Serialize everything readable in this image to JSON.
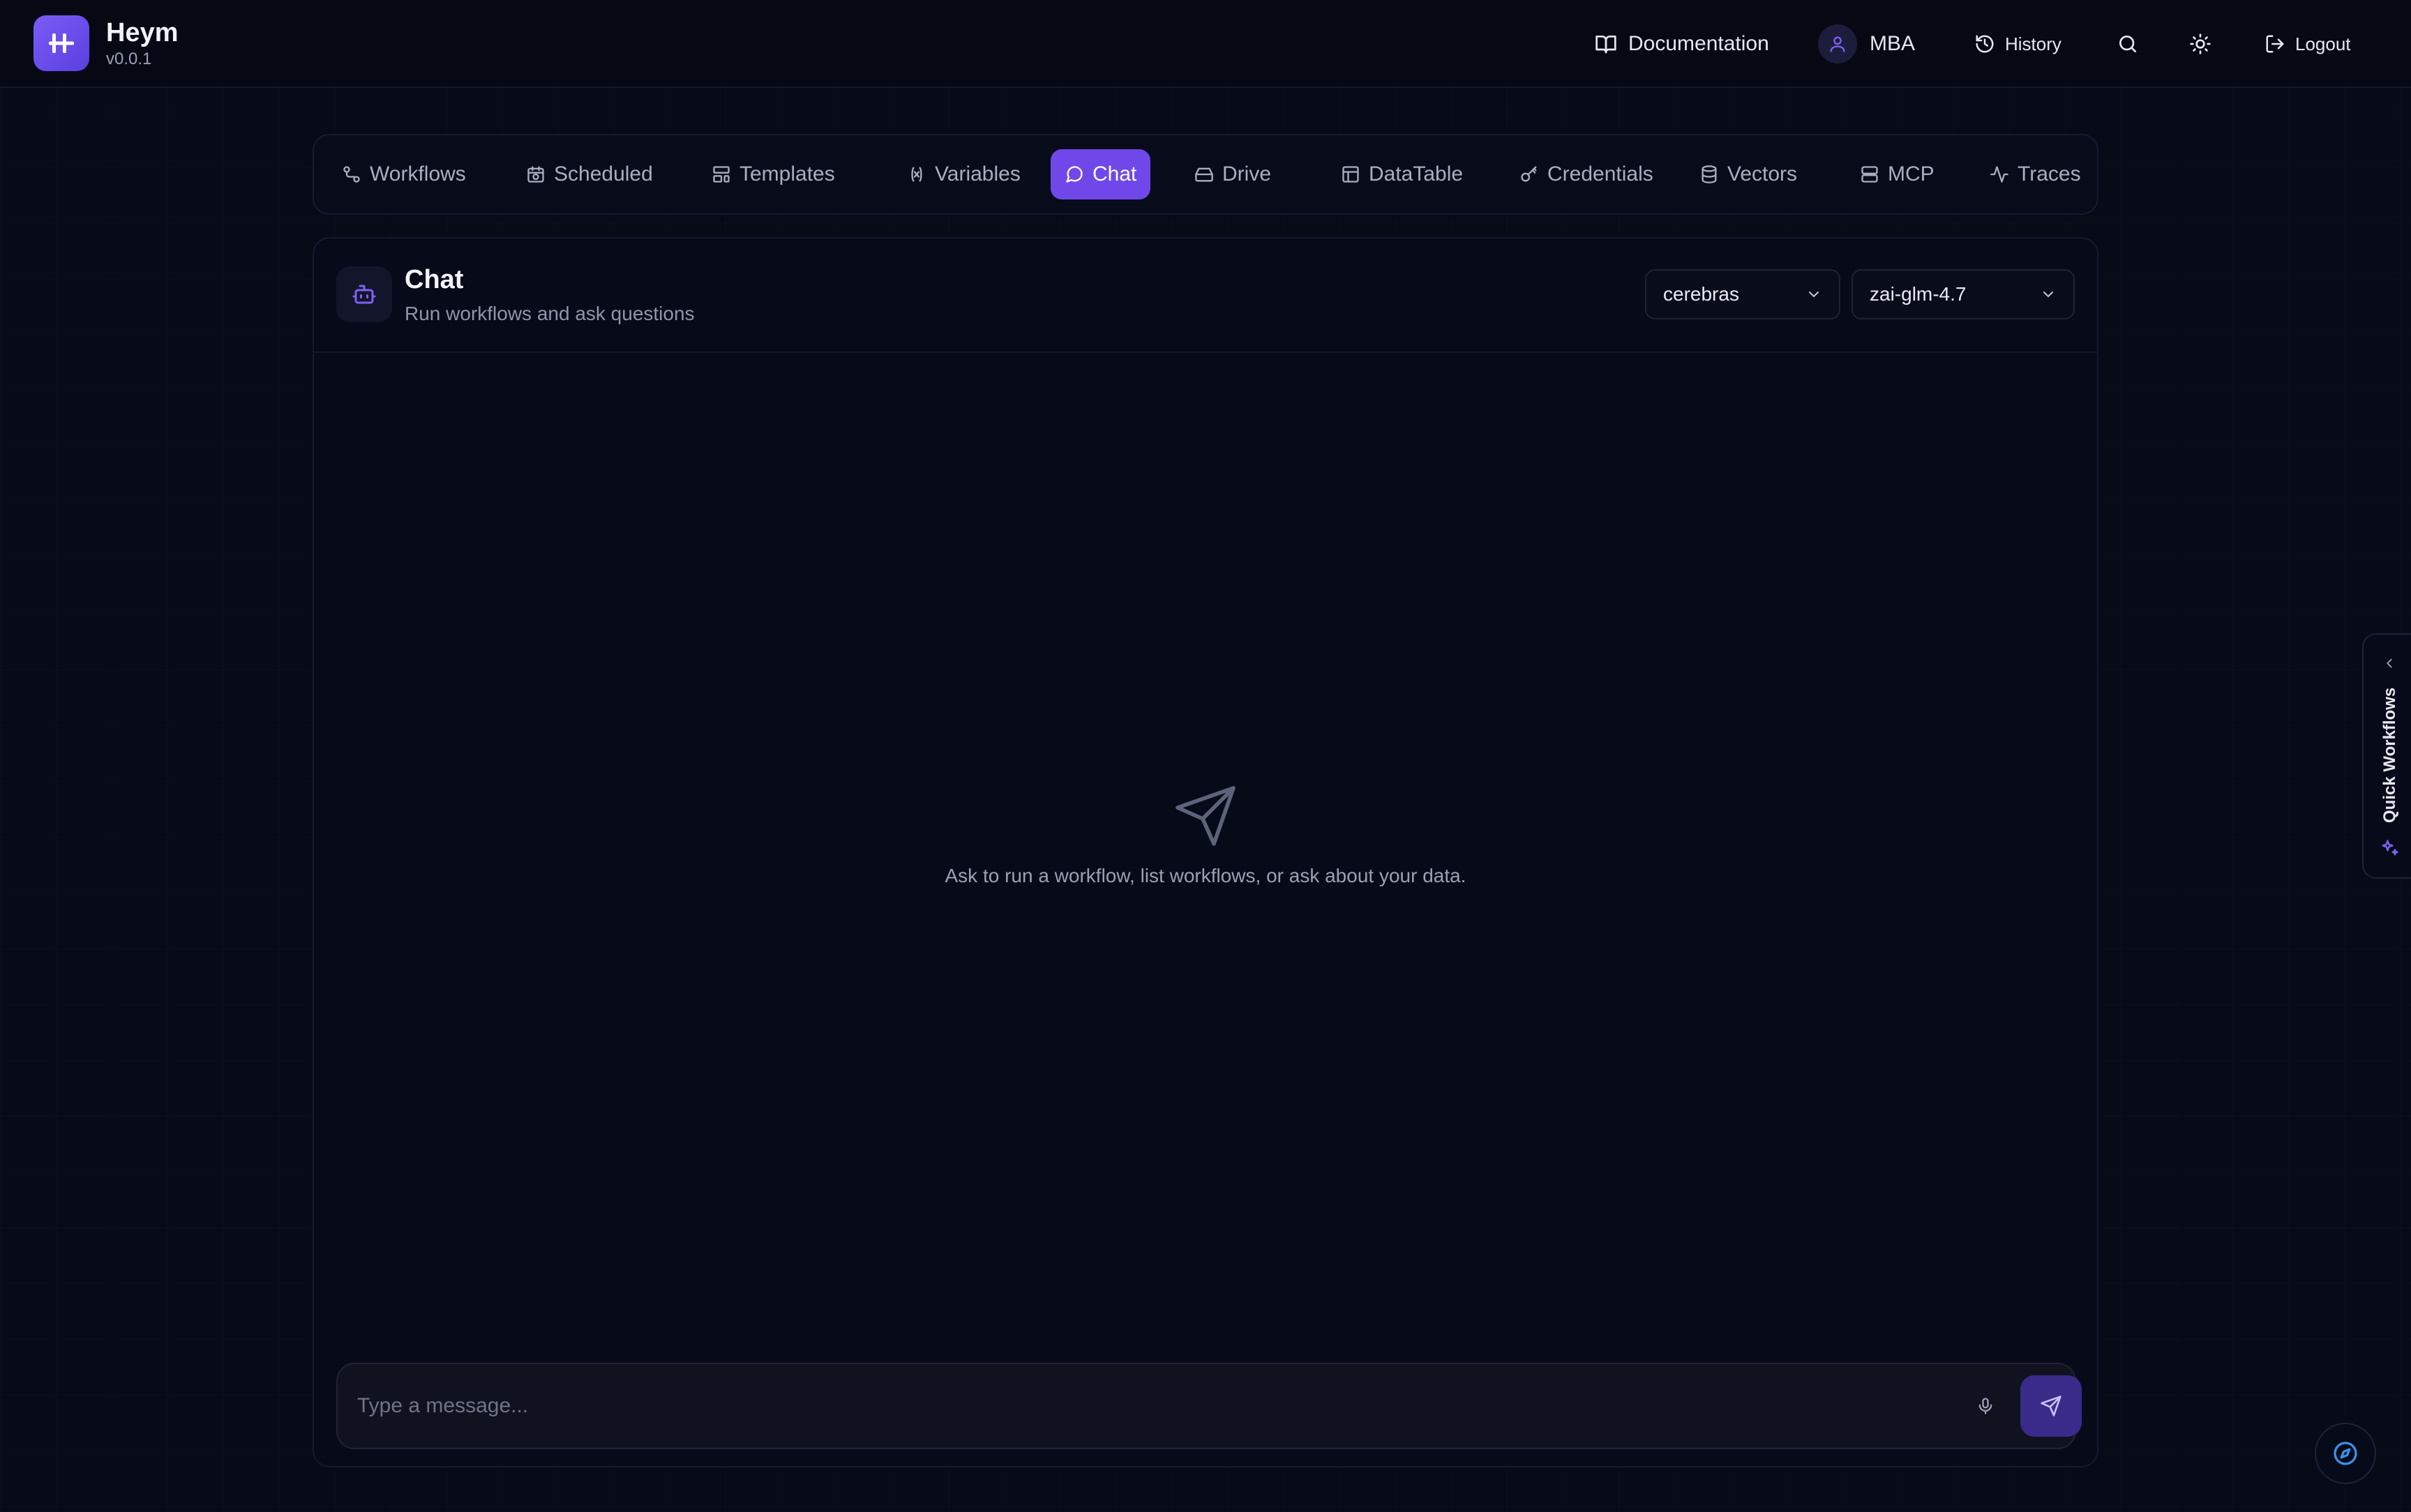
{
  "app": {
    "name": "Heym",
    "version": "v0.0.1"
  },
  "header": {
    "documentation": "Documentation",
    "user": "MBA",
    "history": "History",
    "logout": "Logout"
  },
  "tabs": [
    {
      "label": "Workflows",
      "icon": "workflows-icon"
    },
    {
      "label": "Scheduled",
      "icon": "calendar-clock-icon"
    },
    {
      "label": "Templates",
      "icon": "layout-template-icon"
    },
    {
      "label": "Variables",
      "icon": "variable-icon"
    },
    {
      "label": "Chat",
      "icon": "message-circle-icon",
      "active": true
    },
    {
      "label": "Drive",
      "icon": "hard-drive-icon"
    },
    {
      "label": "DataTable",
      "icon": "table-icon"
    },
    {
      "label": "Credentials",
      "icon": "key-icon"
    },
    {
      "label": "Vectors",
      "icon": "database-icon"
    },
    {
      "label": "MCP",
      "icon": "server-icon"
    },
    {
      "label": "Traces",
      "icon": "activity-icon"
    }
  ],
  "chat": {
    "title": "Chat",
    "subtitle": "Run workflows and ask questions",
    "provider": "cerebras",
    "model": "zai-glm-4.7",
    "empty_message": "Ask to run a workflow, list workflows, or ask about your data.",
    "input_placeholder": "Type a message..."
  },
  "sidebar": {
    "quick_workflows": "Quick Workflows"
  },
  "colors": {
    "accent": "#7048ea",
    "background": "#070a17"
  }
}
